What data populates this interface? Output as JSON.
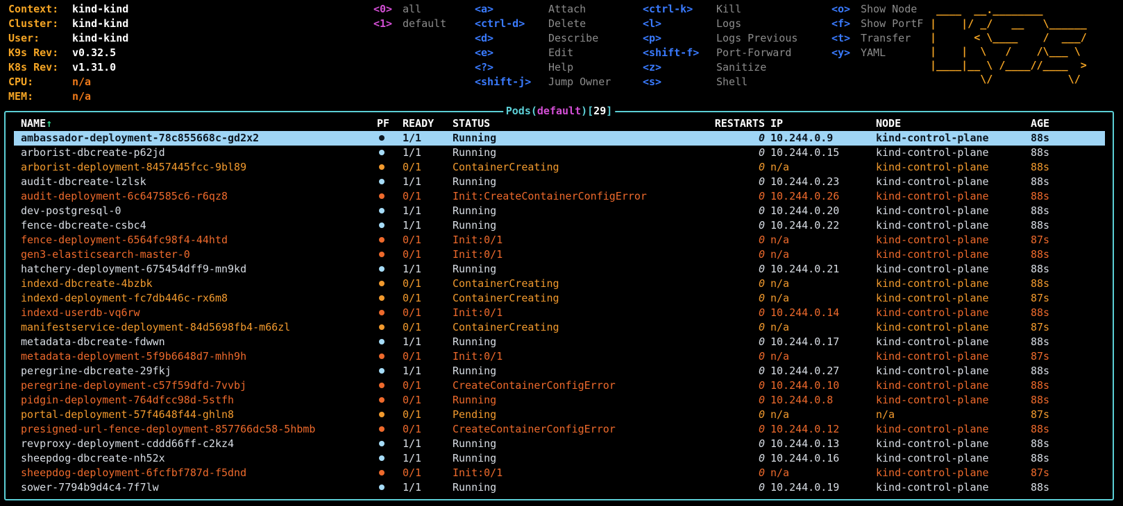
{
  "info": [
    {
      "key": "Context:",
      "value": "kind-kind",
      "na": false
    },
    {
      "key": "Cluster:",
      "value": "kind-kind",
      "na": false
    },
    {
      "key": "User:",
      "value": "kind-kind",
      "na": false
    },
    {
      "key": "K9s Rev:",
      "value": "v0.32.5",
      "na": false
    },
    {
      "key": "K8s Rev:",
      "value": "v1.31.0",
      "na": false
    },
    {
      "key": "CPU:",
      "value": "n/a",
      "na": true
    },
    {
      "key": "MEM:",
      "value": "n/a",
      "na": true
    }
  ],
  "namespaces": [
    {
      "key": "<0>",
      "label": "all"
    },
    {
      "key": "<1>",
      "label": "default"
    }
  ],
  "hotkeys": [
    [
      {
        "key": "<a>",
        "label": "Attach"
      },
      {
        "key": "<ctrl-d>",
        "label": "Delete"
      },
      {
        "key": "<d>",
        "label": "Describe"
      },
      {
        "key": "<e>",
        "label": "Edit"
      },
      {
        "key": "<?>",
        "label": "Help"
      },
      {
        "key": "<shift-j>",
        "label": "Jump Owner"
      }
    ],
    [
      {
        "key": "<ctrl-k>",
        "label": "Kill"
      },
      {
        "key": "<l>",
        "label": "Logs"
      },
      {
        "key": "<p>",
        "label": "Logs Previous"
      },
      {
        "key": "<shift-f>",
        "label": "Port-Forward"
      },
      {
        "key": "<z>",
        "label": "Sanitize"
      },
      {
        "key": "<s>",
        "label": "Shell"
      }
    ],
    [
      {
        "key": "<o>",
        "label": "Show Node"
      },
      {
        "key": "<f>",
        "label": "Show PortF"
      },
      {
        "key": "<t>",
        "label": "Transfer"
      },
      {
        "key": "<y>",
        "label": "YAML"
      }
    ]
  ],
  "logo": " ____  __.________       \n|    |/ _/   __   \\______\n|      < \\____    /  ___/\n|    |  \\   /    /\\___ \\ \n|____|__ \\ /____//____  >\n        \\/            \\/ ",
  "pods_title": {
    "name": "Pods",
    "namespace": "default",
    "count": "29"
  },
  "columns": {
    "name": "NAME",
    "sort_arrow": "↑",
    "pf": "PF",
    "ready": "READY",
    "status": "STATUS",
    "restarts": "RESTARTS",
    "ip": "IP",
    "node": "NODE",
    "age": "AGE"
  },
  "colors": {
    "ok": "#d8dde4",
    "pending": "#f29a2e",
    "error": "#ee6a2c",
    "selected_bg": "#9fd5f5",
    "frame": "#5ccfd6",
    "info_key": "#f5a524",
    "hotkey": "#3a7bff",
    "namespace_key": "#d44fd6"
  },
  "pods": [
    {
      "name": "ambassador-deployment-78c855668c-gd2x2",
      "ready": "1/1",
      "status": "Running",
      "restarts": "0",
      "ip": "10.244.0.9",
      "node": "kind-control-plane",
      "age": "88s",
      "state": "sel"
    },
    {
      "name": "arborist-dbcreate-p62jd",
      "ready": "1/1",
      "status": "Running",
      "restarts": "0",
      "ip": "10.244.0.15",
      "node": "kind-control-plane",
      "age": "88s",
      "state": "ok"
    },
    {
      "name": "arborist-deployment-8457445fcc-9bl89",
      "ready": "0/1",
      "status": "ContainerCreating",
      "restarts": "0",
      "ip": "n/a",
      "node": "kind-control-plane",
      "age": "88s",
      "state": "pend"
    },
    {
      "name": "audit-dbcreate-lzlsk",
      "ready": "1/1",
      "status": "Running",
      "restarts": "0",
      "ip": "10.244.0.23",
      "node": "kind-control-plane",
      "age": "88s",
      "state": "ok"
    },
    {
      "name": "audit-deployment-6c647585c6-r6qz8",
      "ready": "0/1",
      "status": "Init:CreateContainerConfigError",
      "restarts": "0",
      "ip": "10.244.0.26",
      "node": "kind-control-plane",
      "age": "88s",
      "state": "err"
    },
    {
      "name": "dev-postgresql-0",
      "ready": "1/1",
      "status": "Running",
      "restarts": "0",
      "ip": "10.244.0.20",
      "node": "kind-control-plane",
      "age": "88s",
      "state": "ok"
    },
    {
      "name": "fence-dbcreate-csbc4",
      "ready": "1/1",
      "status": "Running",
      "restarts": "0",
      "ip": "10.244.0.22",
      "node": "kind-control-plane",
      "age": "88s",
      "state": "ok"
    },
    {
      "name": "fence-deployment-6564fc98f4-44htd",
      "ready": "0/1",
      "status": "Init:0/1",
      "restarts": "0",
      "ip": "n/a",
      "node": "kind-control-plane",
      "age": "87s",
      "state": "err"
    },
    {
      "name": "gen3-elasticsearch-master-0",
      "ready": "0/1",
      "status": "Init:0/1",
      "restarts": "0",
      "ip": "n/a",
      "node": "kind-control-plane",
      "age": "88s",
      "state": "err"
    },
    {
      "name": "hatchery-deployment-675454dff9-mn9kd",
      "ready": "1/1",
      "status": "Running",
      "restarts": "0",
      "ip": "10.244.0.21",
      "node": "kind-control-plane",
      "age": "88s",
      "state": "ok"
    },
    {
      "name": "indexd-dbcreate-4bzbk",
      "ready": "0/1",
      "status": "ContainerCreating",
      "restarts": "0",
      "ip": "n/a",
      "node": "kind-control-plane",
      "age": "88s",
      "state": "pend"
    },
    {
      "name": "indexd-deployment-fc7db446c-rx6m8",
      "ready": "0/1",
      "status": "ContainerCreating",
      "restarts": "0",
      "ip": "n/a",
      "node": "kind-control-plane",
      "age": "87s",
      "state": "pend"
    },
    {
      "name": "indexd-userdb-vq6rw",
      "ready": "0/1",
      "status": "Init:0/1",
      "restarts": "0",
      "ip": "10.244.0.14",
      "node": "kind-control-plane",
      "age": "88s",
      "state": "err"
    },
    {
      "name": "manifestservice-deployment-84d5698fb4-m66zl",
      "ready": "0/1",
      "status": "ContainerCreating",
      "restarts": "0",
      "ip": "n/a",
      "node": "kind-control-plane",
      "age": "87s",
      "state": "pend"
    },
    {
      "name": "metadata-dbcreate-fdwwn",
      "ready": "1/1",
      "status": "Running",
      "restarts": "0",
      "ip": "10.244.0.17",
      "node": "kind-control-plane",
      "age": "88s",
      "state": "ok"
    },
    {
      "name": "metadata-deployment-5f9b6648d7-mhh9h",
      "ready": "0/1",
      "status": "Init:0/1",
      "restarts": "0",
      "ip": "n/a",
      "node": "kind-control-plane",
      "age": "87s",
      "state": "err"
    },
    {
      "name": "peregrine-dbcreate-29fkj",
      "ready": "1/1",
      "status": "Running",
      "restarts": "0",
      "ip": "10.244.0.27",
      "node": "kind-control-plane",
      "age": "88s",
      "state": "ok"
    },
    {
      "name": "peregrine-deployment-c57f59dfd-7vvbj",
      "ready": "0/1",
      "status": "CreateContainerConfigError",
      "restarts": "0",
      "ip": "10.244.0.10",
      "node": "kind-control-plane",
      "age": "88s",
      "state": "err"
    },
    {
      "name": "pidgin-deployment-764dfcc98d-5stfh",
      "ready": "0/1",
      "status": "Running",
      "restarts": "0",
      "ip": "10.244.0.8",
      "node": "kind-control-plane",
      "age": "88s",
      "state": "err"
    },
    {
      "name": "portal-deployment-57f4648f44-ghln8",
      "ready": "0/1",
      "status": "Pending",
      "restarts": "0",
      "ip": "n/a",
      "node": "n/a",
      "age": "87s",
      "state": "pend"
    },
    {
      "name": "presigned-url-fence-deployment-857766dc58-5hbmb",
      "ready": "0/1",
      "status": "CreateContainerConfigError",
      "restarts": "0",
      "ip": "10.244.0.12",
      "node": "kind-control-plane",
      "age": "88s",
      "state": "err"
    },
    {
      "name": "revproxy-deployment-cddd66ff-c2kz4",
      "ready": "1/1",
      "status": "Running",
      "restarts": "0",
      "ip": "10.244.0.13",
      "node": "kind-control-plane",
      "age": "88s",
      "state": "ok"
    },
    {
      "name": "sheepdog-dbcreate-nh52x",
      "ready": "1/1",
      "status": "Running",
      "restarts": "0",
      "ip": "10.244.0.16",
      "node": "kind-control-plane",
      "age": "88s",
      "state": "ok"
    },
    {
      "name": "sheepdog-deployment-6fcfbf787d-f5dnd",
      "ready": "0/1",
      "status": "Init:0/1",
      "restarts": "0",
      "ip": "n/a",
      "node": "kind-control-plane",
      "age": "87s",
      "state": "err"
    },
    {
      "name": "sower-7794b9d4c4-7f7lw",
      "ready": "1/1",
      "status": "Running",
      "restarts": "0",
      "ip": "10.244.0.19",
      "node": "kind-control-plane",
      "age": "88s",
      "state": "ok"
    }
  ]
}
